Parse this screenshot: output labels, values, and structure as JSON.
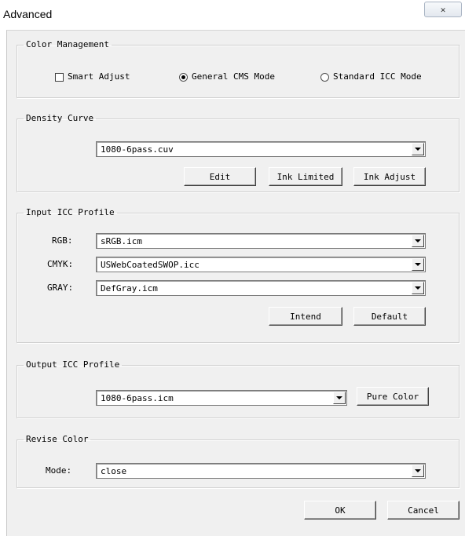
{
  "window": {
    "title": "Advanced",
    "close_glyph": "✕"
  },
  "color_management": {
    "legend": "Color Management",
    "smart_adjust": {
      "label": "Smart Adjust",
      "checked": false
    },
    "general_cms": {
      "label": "General CMS Mode",
      "selected": true
    },
    "standard_icc": {
      "label": "Standard ICC Mode",
      "selected": false
    }
  },
  "density_curve": {
    "legend": "Density Curve",
    "file": "1080-6pass.cuv",
    "edit": "Edit",
    "ink_limited": "Ink Limited",
    "ink_adjust": "Ink Adjust"
  },
  "input_icc": {
    "legend": "Input ICC Profile",
    "rgb_label": "RGB:",
    "rgb_value": "sRGB.icm",
    "cmyk_label": "CMYK:",
    "cmyk_value": "USWebCoatedSWOP.icc",
    "gray_label": "GRAY:",
    "gray_value": "DefGray.icm",
    "intend": "Intend",
    "default": "Default"
  },
  "output_icc": {
    "legend": "Output ICC Profile",
    "value": "1080-6pass.icm",
    "pure_color": "Pure Color"
  },
  "revise_color": {
    "legend": "Revise Color",
    "mode_label": "Mode:",
    "mode_value": "close"
  },
  "footer": {
    "ok": "OK",
    "cancel": "Cancel"
  }
}
